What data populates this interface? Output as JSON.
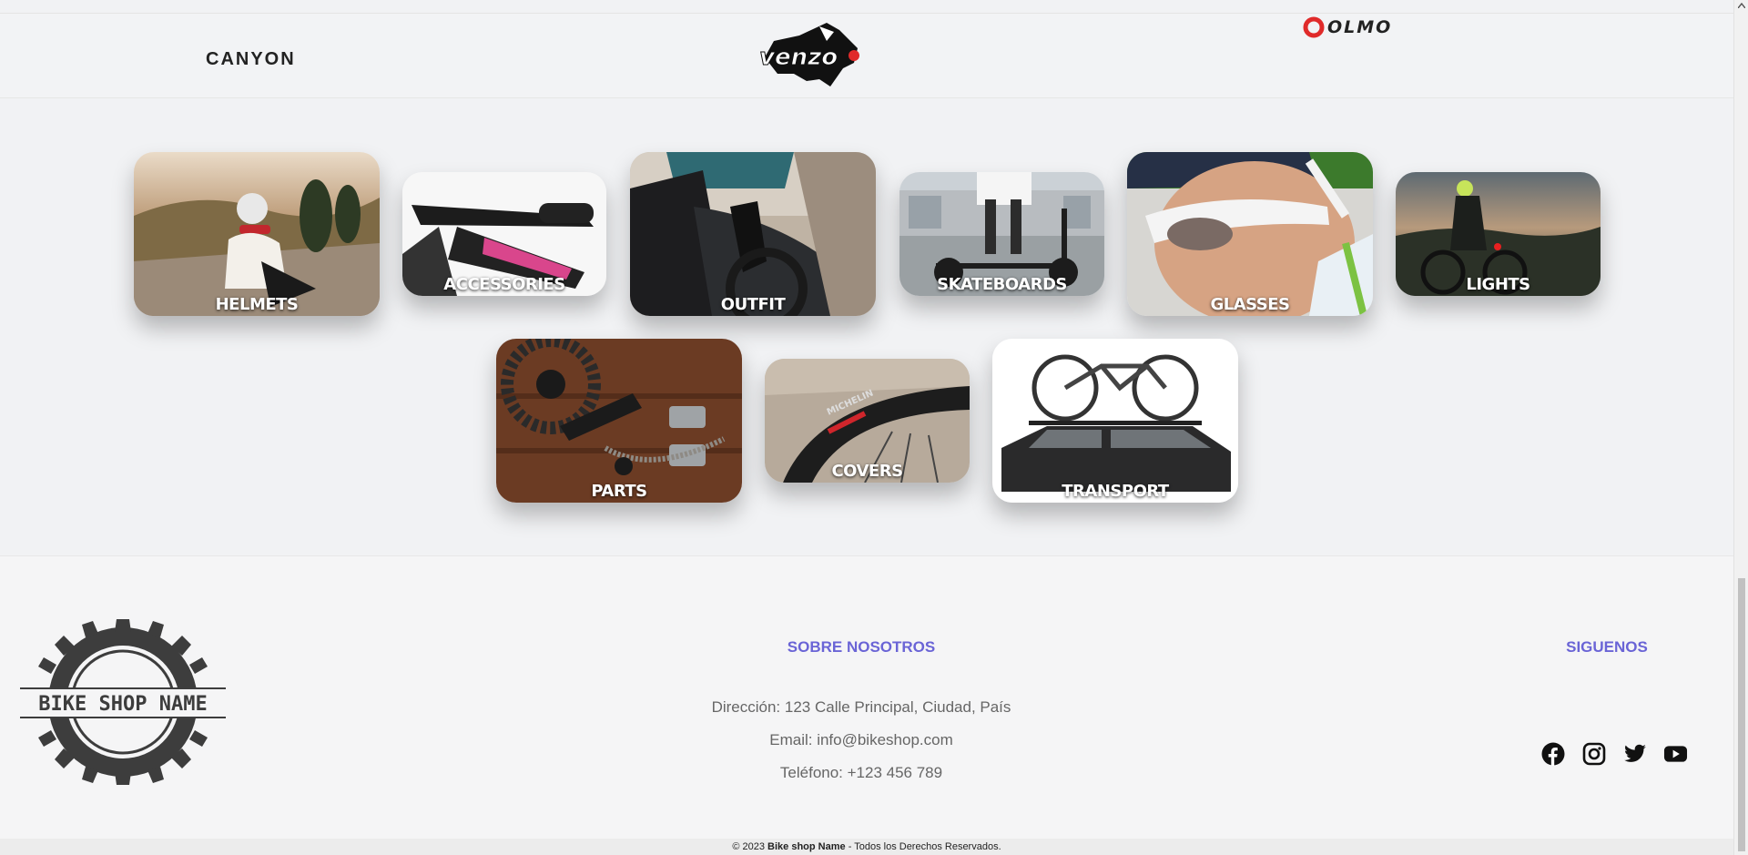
{
  "brands": [
    {
      "name": "CANYON",
      "icon": "canyon-logo"
    },
    {
      "name": "venzo",
      "icon": "venzo-logo"
    },
    {
      "name": "OLMO",
      "icon": "olmo-logo"
    }
  ],
  "categories": [
    {
      "label": "HELMETS"
    },
    {
      "label": "ACCESSORIES"
    },
    {
      "label": "OUTFIT"
    },
    {
      "label": "SKATEBOARDS"
    },
    {
      "label": "GLASSES"
    },
    {
      "label": "LIGHTS"
    },
    {
      "label": "PARTS"
    },
    {
      "label": "COVERS"
    },
    {
      "label": "TRANSPORT"
    }
  ],
  "footer": {
    "logo_text": "BIKE SHOP NAME",
    "about": {
      "title": "SOBRE NOSOTROS",
      "address": "Dirección: 123 Calle Principal, Ciudad, País",
      "email": "Email: info@bikeshop.com",
      "phone": "Teléfono: +123 456 789"
    },
    "follow": {
      "title": "SIGUENOS",
      "icons": [
        "facebook-icon",
        "instagram-icon",
        "twitter-icon",
        "youtube-icon"
      ]
    },
    "copyright": {
      "prefix": "© 2023 ",
      "brand": "Bike shop Name",
      "suffix": " - Todos los Derechos Reservados."
    }
  },
  "colors": {
    "accent": "#6a64d6",
    "background": "#f1f2f4"
  }
}
